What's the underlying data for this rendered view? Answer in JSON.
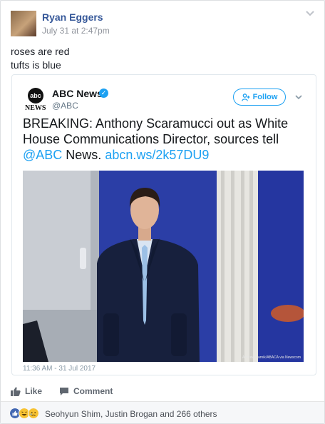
{
  "post": {
    "author": "Ryan Eggers",
    "timestamp": "July 31 at 2:47pm",
    "text_lines": [
      "roses are red",
      "tufts is blue"
    ]
  },
  "tweet": {
    "logo_text": "abc",
    "logo_word": "NEWS",
    "account_name": "ABC News",
    "handle": "@ABC",
    "follow_label": "Follow",
    "text_before": "BREAKING: Anthony Scaramucci out as White House Communications Director, sources tell ",
    "mention": "@ABC",
    "text_middle": " News. ",
    "link": "abcn.ws/2k57DU9",
    "photo_credit": "Andrew Harnik/ABACA via Newscom",
    "time": "11:36 AM - 31 Jul 2017"
  },
  "actions": {
    "like": "Like",
    "comment": "Comment"
  },
  "reactions": {
    "summary": "Seohyun Shim, Justin Brogan and 266 others"
  },
  "colors": {
    "facebook_link": "#365899",
    "twitter_blue": "#1da1f2"
  },
  "icons": [
    "chevron-down-icon",
    "verified-icon",
    "follow-person-icon",
    "like-thumb-icon",
    "comment-bubble-icon",
    "like-reaction-icon",
    "haha-reaction-icon",
    "sad-reaction-icon"
  ]
}
